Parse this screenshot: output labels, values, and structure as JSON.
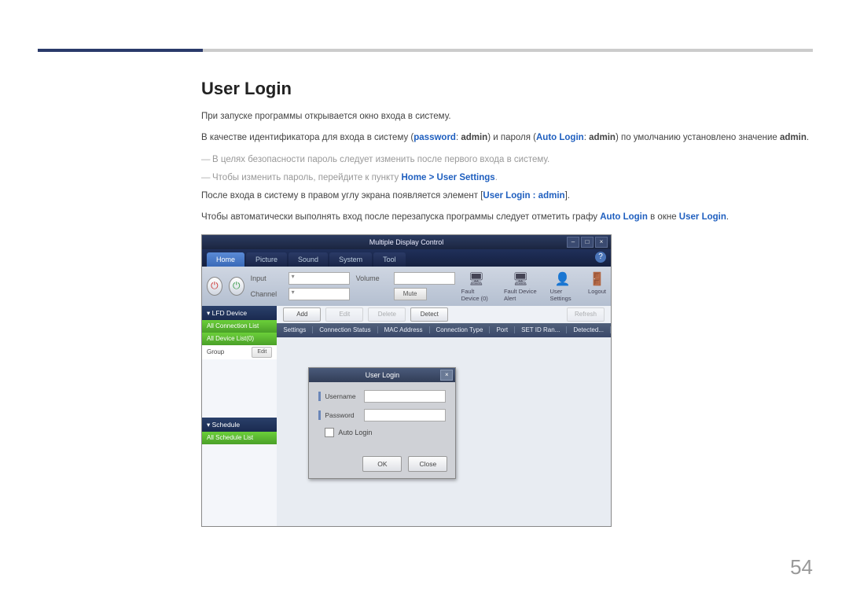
{
  "page_number": "54",
  "section_title": "User Login",
  "paragraphs": {
    "p1": "При запуске программы открывается окно входа в систему.",
    "p2_a": "В качестве идентификатора для входа в систему (",
    "p2_pw": "password",
    "p2_b": ": ",
    "p2_admin1": "admin",
    "p2_c": ") и пароля (",
    "p2_al": "Auto Login",
    "p2_d": ": ",
    "p2_admin2": "admin",
    "p2_e": ") по умолчанию установлено значение ",
    "p2_admin3": "admin",
    "p2_f": ".",
    "n1": "В целях безопасности пароль следует изменить после первого входа в систему.",
    "n2_a": "Чтобы изменить пароль, перейдите к пункту ",
    "n2_home": "Home",
    "n2_sep": " > ",
    "n2_us": "User Settings",
    "n2_b": ".",
    "p3_a": "После входа в систему в правом углу экрана появляется элемент [",
    "p3_ul": "User Login : admin",
    "p3_b": "].",
    "p4_a": "Чтобы автоматически выполнять вход после перезапуска программы следует отметить графу ",
    "p4_al": "Auto Login",
    "p4_b": " в окне ",
    "p4_ul": "User Login",
    "p4_c": "."
  },
  "app": {
    "title": "Multiple Display Control",
    "tabs": [
      "Home",
      "Picture",
      "Sound",
      "System",
      "Tool"
    ],
    "ribbon": {
      "input_label": "Input",
      "channel_label": "Channel",
      "volume_label": "Volume",
      "mute_btn": "Mute",
      "icons": {
        "fault_device": "Fault Device (0)",
        "fault_alert": "Fault Device Alert",
        "user_settings": "User Settings",
        "logout": "Logout"
      }
    },
    "sidebar": {
      "lfd": "LFD Device",
      "all_conn": "All Connection List",
      "all_dev": "All Device List(0)",
      "group": "Group",
      "edit": "Edit",
      "schedule": "Schedule",
      "all_sched": "All Schedule List"
    },
    "main": {
      "buttons": {
        "add": "Add",
        "edit": "Edit",
        "delete": "Delete",
        "detect": "Detect",
        "refresh": "Refresh"
      },
      "columns": [
        "Settings",
        "Connection Status",
        "MAC Address",
        "Connection Type",
        "Port",
        "SET ID Ran...",
        "Detected..."
      ]
    },
    "dialog": {
      "title": "User Login",
      "username": "Username",
      "password": "Password",
      "auto_login": "Auto Login",
      "ok": "OK",
      "close": "Close"
    }
  }
}
